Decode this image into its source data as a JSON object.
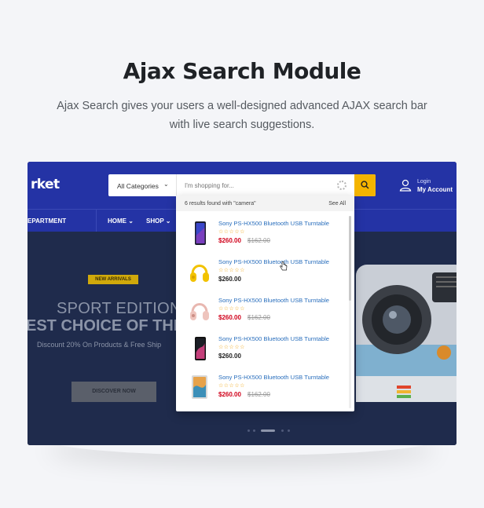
{
  "page": {
    "title": "Ajax Search Module",
    "description": "Ajax Search gives your users a well-designed advanced AJAX search bar with live search suggestions."
  },
  "header": {
    "logo_text": "rket",
    "category_select": "All Categories",
    "search_placeholder": "I'm shopping for...",
    "account_line1": "Login",
    "account_line2": "My Account",
    "brand_color": "#2433a5",
    "search_button_color": "#f4b400"
  },
  "nav": {
    "department": "EPARTMENT",
    "items": [
      {
        "label": "HOME"
      },
      {
        "label": "SHOP"
      }
    ]
  },
  "hero": {
    "badge": "NEW ARRIVALS",
    "line1": "SPORT EDITION",
    "line2": "EST CHOICE OF THE Y",
    "discount": "Discount 20% On Products & Free Ship",
    "button": "DISCOVER NOW"
  },
  "search_results": {
    "summary": "6 results found with \"camera\"",
    "see_all": "See All",
    "items": [
      {
        "name": "Sony PS-HX500 Bluetooth USB Turntable",
        "price": "$260.00",
        "old_price": "$162.00",
        "rating": 0,
        "thumb": "phone-icon",
        "sale": true
      },
      {
        "name": "Sony PS-HX500 Bluetooth USB Turntable",
        "price": "$260.00",
        "old_price": "",
        "rating": 0,
        "thumb": "headphones-icon",
        "sale": false
      },
      {
        "name": "Sony PS-HX500 Bluetooth USB Turntable",
        "price": "$260.00",
        "old_price": "$162.00",
        "rating": 0,
        "thumb": "headphones-icon",
        "sale": true
      },
      {
        "name": "Sony PS-HX500 Bluetooth USB Turntable",
        "price": "$260.00",
        "old_price": "",
        "rating": 0,
        "thumb": "phone-icon",
        "sale": false
      },
      {
        "name": "Sony PS-HX500 Bluetooth USB Turntable",
        "price": "$260.00",
        "old_price": "$162.00",
        "rating": 0,
        "thumb": "tablet-icon",
        "sale": true
      }
    ],
    "star_glyphs": "☆☆☆☆☆",
    "sale_color": "#d0021b",
    "regular_color": "#222222"
  }
}
